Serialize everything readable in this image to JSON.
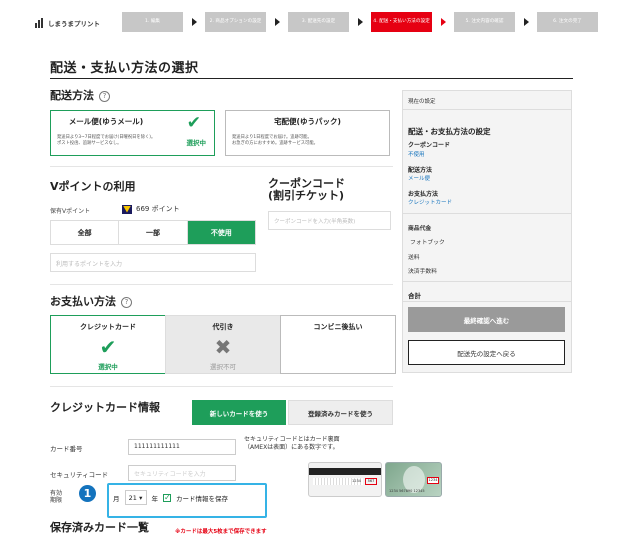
{
  "header": {
    "logo_text": "しまうまプリント",
    "steps": [
      {
        "label": "1. 編集",
        "active": false
      },
      {
        "label": "2. 商品オプションの設定",
        "active": false
      },
      {
        "label": "3. 配送先の設定",
        "active": false
      },
      {
        "label": "4. 配送・支払い方法の設定",
        "active": true
      },
      {
        "label": "5. 注文内容の確認",
        "active": false
      },
      {
        "label": "6. 注文の完了",
        "active": false
      }
    ]
  },
  "page_title": "配送・支払い方法の選択",
  "shipping": {
    "title": "配送方法",
    "help": "?",
    "options": [
      {
        "name": "メール便(ゆうメール)",
        "desc_line1": "発送日より3~7日程度でお届け(日曜祝日を除く)。",
        "desc_line2": "ポスト投函、追跡サービスなし。",
        "selected_label": "選択中"
      },
      {
        "name": "宅配便(ゆうパック)",
        "desc_line1": "発送日より1日程度でお届け。追跡可能。",
        "desc_line2": "お急ぎの方におすすめ。追跡サービス可能。"
      }
    ]
  },
  "vpoint": {
    "title": "Vポイントの利用",
    "held_label": "保有Vポイント",
    "held_value": "669 ポイント",
    "segments": [
      "全部",
      "一部",
      "不使用"
    ],
    "active_segment": 2,
    "input_placeholder": "利用するポイントを入力"
  },
  "coupon": {
    "title_line1": "クーポンコード",
    "title_line2": "(割引チケット)",
    "input_placeholder": "クーポンコードを入力(半角英数)"
  },
  "payment": {
    "title": "お支払い方法",
    "help": "?",
    "options": [
      {
        "name": "クレジットカード",
        "mark": "✔",
        "status": "選択中",
        "state": "selected"
      },
      {
        "name": "代引き",
        "mark": "✖",
        "status": "選択不可",
        "state": "disabled"
      },
      {
        "name": "コンビニ後払い",
        "mark": "",
        "status": "",
        "state": "normal"
      }
    ]
  },
  "credit_card": {
    "title": "クレジットカード情報",
    "tab_new": "新しいカードを使う",
    "tab_saved": "登録済みカードを使う",
    "number_label": "カード番号",
    "number_value": "111111111111",
    "security_label": "セキュリティコード",
    "security_placeholder": "セキュリティコードを入力",
    "note_line1": "セキュリティコードとはカード裏面",
    "note_line2": "（AMEXは表面）にある数字です。",
    "card_back_number": "1234",
    "card_back_code": "567",
    "card_front_number": "1234 567890 12345",
    "card_front_code": "1234",
    "expiry_label_line1": "有効",
    "expiry_label_line2": "期限",
    "badge": "1",
    "month_unit": "月",
    "year_value": "21",
    "year_unit": "年",
    "save_label": "カード情報を保存"
  },
  "saved_cards": {
    "title": "保存済みカード一覧",
    "note": "※カードは最大5枚まで保存できます"
  },
  "sidebar": {
    "header": "現在の設定",
    "title": "配送・お支払方法の設定",
    "coupon_label": "クーポンコード",
    "coupon_value": "不使用",
    "shipping_label": "配送方法",
    "shipping_value": "メール便",
    "payment_label": "お支払方法",
    "payment_value": "クレジットカード",
    "items": [
      "商品代金",
      "フォトブック",
      "送料",
      "決済手数料"
    ],
    "total_label": "合計",
    "confirm_button": "最終確認へ進む",
    "back_button": "配送先の設定へ戻る"
  },
  "colors": {
    "accent_green": "#1e9e5a",
    "step_active": "#e60012",
    "step_inactive": "#c7c7c7",
    "highlight_blue": "#35b3e6"
  }
}
